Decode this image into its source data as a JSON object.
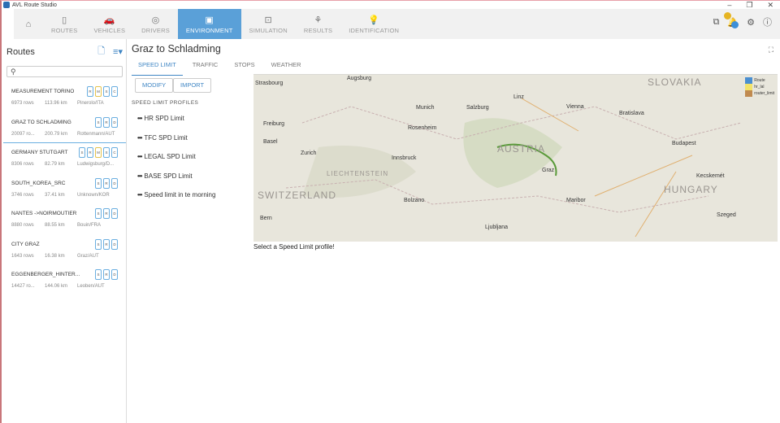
{
  "app": {
    "title": "AVL Route Studio",
    "window_controls": [
      "–",
      "❐",
      "✕"
    ]
  },
  "nav": {
    "tabs": [
      {
        "label": "ROUTES",
        "icon": "▯"
      },
      {
        "label": "VEHICLES",
        "icon": "🚗"
      },
      {
        "label": "DRIVERS",
        "icon": "◎"
      },
      {
        "label": "ENVIRONMENT",
        "icon": "▣",
        "active": true
      },
      {
        "label": "SIMULATION",
        "icon": "⊡"
      },
      {
        "label": "RESULTS",
        "icon": "⚘"
      },
      {
        "label": "IDENTIFICATION",
        "icon": "💡"
      }
    ],
    "home_icon": "⌂"
  },
  "sidebar": {
    "title": "Routes",
    "search_placeholder": "",
    "routes": [
      {
        "name": "MEASUREMENT TORINO",
        "rows": "6973 rows",
        "km": "113.96 km",
        "loc": "Pinerolo/ITA",
        "tags": [
          "R",
          "M",
          "S",
          "C"
        ]
      },
      {
        "name": "GRAZ TO SCHLADMING",
        "rows": "20097 ro...",
        "km": "200.79 km",
        "loc": "Rottenmann/AUT",
        "tags": [
          "S",
          "R",
          "D"
        ],
        "selected": true
      },
      {
        "name": "GERMANY STUTGART",
        "rows": "8306 rows",
        "km": "82.79 km",
        "loc": "Ludwigsburg/D...",
        "tags": [
          "S",
          "R",
          "M",
          "S",
          "C"
        ]
      },
      {
        "name": "SOUTH_KOREA_SRC",
        "rows": "3746 rows",
        "km": "37.41 km",
        "loc": "Unknown/KOR",
        "tags": [
          "S",
          "R",
          "D"
        ]
      },
      {
        "name": "NANTES ->NOIRMOUTIER",
        "rows": "8880 rows",
        "km": "88.55 km",
        "loc": "Bouin/FRA",
        "tags": [
          "S",
          "R",
          "D"
        ]
      },
      {
        "name": "CITY GRAZ",
        "rows": "1643 rows",
        "km": "16.38 km",
        "loc": "Graz/AUT",
        "tags": [
          "S",
          "R",
          "D"
        ]
      },
      {
        "name": "EGGENBERGER_HINTER...",
        "rows": "14427 ro...",
        "km": "144.06 km",
        "loc": "Leoben/AUT",
        "tags": [
          "S",
          "R",
          "D"
        ]
      }
    ]
  },
  "main": {
    "title": "Graz to Schladming",
    "tabs": [
      "SPEED LIMIT",
      "TRAFFIC",
      "STOPS",
      "WEATHER"
    ],
    "modify": "MODIFY",
    "import": "IMPORT",
    "profiles_label": "SPEED LIMIT PROFILES",
    "profiles": [
      "HR SPD Limit",
      "TFC SPD Limit",
      "LEGAL SPD Limit",
      "BASE SPD Limit",
      "Speed limit in te morning"
    ],
    "message": "Select a Speed Limit profile!"
  },
  "map": {
    "labels": [
      "Strasbourg",
      "Augsburg",
      "Munich",
      "Vienna",
      "Bratislava",
      "Budapest",
      "Salzburg",
      "Innsbruck",
      "Zurich",
      "Basel",
      "Bern",
      "Graz",
      "Ljubljana",
      "Bolzano",
      "Maribor",
      "Szeged",
      "Kecskemét",
      "Linz",
      "Rosenheim",
      "Freiburg"
    ],
    "regions": [
      "SLOVAKIA",
      "AUSTRIA",
      "HUNGARY",
      "SWITZERLAND",
      "LIECHTENSTEIN"
    ],
    "legend": [
      "Route",
      "hr_lal",
      "router_limit"
    ]
  }
}
